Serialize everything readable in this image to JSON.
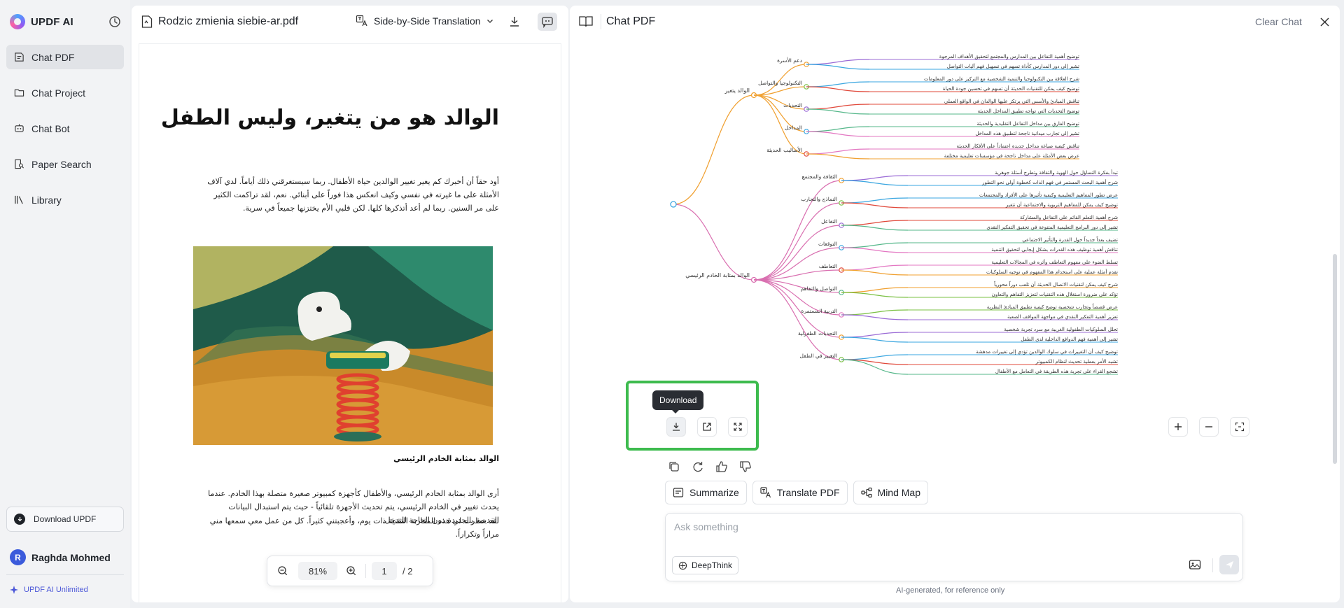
{
  "app": {
    "name": "UPDF AI"
  },
  "sidebar": {
    "items": [
      {
        "label": "Chat PDF",
        "icon": "chat-pdf-icon",
        "active": true
      },
      {
        "label": "Chat Project",
        "icon": "folder-icon"
      },
      {
        "label": "Chat Bot",
        "icon": "bot-icon"
      },
      {
        "label": "Paper Search",
        "icon": "search-doc-icon"
      },
      {
        "label": "Library",
        "icon": "library-icon"
      }
    ],
    "download_label": "Download UPDF",
    "user": {
      "initial": "R",
      "name": "Raghda Mohmed"
    },
    "plan_label": "UPDF AI Unlimited"
  },
  "pdf": {
    "file_name": "Rodzic zmienia siebie-ar.pdf",
    "translate_label": "Side-by-Side Translation",
    "title": "الوالد هو من يتغير، وليس الطفل",
    "para1": "أود حقاً أن أخبرك كم يغير تغيير الوالدين حياة الأطفال. ربما سيستغرقني ذلك أياماً. لدي آلاف الأمثلة على ما غيرته في نفسي وكيف انعكس هذا فوراً على أبنائي. نعم، لقد تراكمت الكثير على مر السنين. ربما لم أعد أتذكرها كلها. لكن قلبي الأم يختزنها جميعاً في سرية.",
    "caption": "الوالد بمثابة الخادم الرئيسي",
    "para2": "أرى الوالد بمثابة الخادم الرئيسي، والأطفال كأجهزة كمبيوتر صغيرة متصلة بهذا الخادم. عندما يحدث تغيير في الخادم الرئيسي، يتم تحديث الأجهزة تلقائياً - حيث يتم استبدال البيانات القديمة بالجديدة دون الحاجة للتدخل.",
    "para3": "لقد خطرت لي هذه المقارنة التقنية ذات يوم، وأعجبتني كثيراً. كل من عمل معي سمعها مني مراراً وتكراراً.",
    "zoom": "81%",
    "page_current": "1",
    "page_total": "/ 2"
  },
  "chat": {
    "title": "Chat PDF",
    "clear_label": "Clear Chat",
    "tooltip": "Download",
    "quick_actions": [
      "Summarize",
      "Translate PDF",
      "Mind Map"
    ],
    "ask_placeholder": "Ask something",
    "deepthink_label": "DeepThink",
    "footnote": "AI-generated, for reference only",
    "mindmap": {
      "branch_a": "الوالد يتغير",
      "branch_b": "الوالد بمثابة الخادم الرئيسي",
      "nodes_top": [
        "دعم الأسرة",
        "التكنولوجيا والتواصل",
        "التحديات",
        "المداخل",
        "الأساليب الحديثة"
      ],
      "nodes_bottom": [
        "الثقافة والمجتمع",
        "النماذج والتجارب",
        "التفاعل",
        "التوقعات",
        "التعاطف",
        "التواصل والتفاهم",
        "التربية المستمرة",
        "التحديات الطفولية",
        "التغيير في الطفل"
      ],
      "leaves_top": [
        "توضيح أهمية التفاعل بين المدارس والمجتمع لتحقيق الأهداف المرجوة",
        "تشير إلى دور المدارس كأداة تسهم في تسهيل فهم آليات التواصل",
        "شرح العلاقة بين التكنولوجيا والتنمية الشخصية مع التركيز على دور المعلومات",
        "توضيح كيف يمكن للتقنيات الحديثة أن تسهم في تحسين جودة الحياة",
        "تناقش المبادئ والأسس التي يرتكز عليها الوالدان في الواقع العملي",
        "توضيح التحديات التي تواجه تطبيق المداخل الحديثة",
        "توضيح الفارق بين مداخل التفاعل التقليدية والحديثة",
        "تشير إلى تجارب ميدانية ناجحة لتطبيق هذه المداخل",
        "تناقش كيفية صياغة مداخل جديدة اعتماداً على الأفكار الحديثة",
        "عرض بعض الأمثلة على مداخل ناجحة في مؤسسات تعليمية مختلفة"
      ],
      "leaves_bottom": [
        "تبدأ بفكرة التساؤل حول الهوية والثقافة وتطرح أسئلة جوهرية",
        "شرح أهمية البحث المستمر في فهم الذات كخطوة أولى نحو التطور",
        "عرض تطور المفاهيم التعليمية وكيفية تأثيرها على الأفراد والمجتمعات",
        "توضيح كيف يمكن للمفاهيم التربوية والاجتماعية أن تتغير",
        "شرح أهمية التعلم القائم على التفاعل والمشاركة",
        "تشير إلى دور البرامج التعليمية المتنوعة في تحقيق التفكير النقدي",
        "تضيف بعداً جديداً حول القدرة والتأثير الاجتماعي",
        "تناقش أهمية توظيف هذه القدرات بشكل إيجابي لتحقيق التنمية",
        "تسلط الضوء على مفهوم التعاطف وأثره في المجالات التعليمية",
        "تقدم أمثلة عملية على استخدام هذا المفهوم في توجيه السلوكيات",
        "شرح كيف يمكن لتقنيات الاتصال الحديثة أن تلعب دوراً محورياً",
        "تؤكد على ضرورة استغلال هذه التقنيات لتعزيز التفاهم والتعاون",
        "عرض قصصاً وتجارب شخصية توضح كيفية تطبيق المبادئ النظرية",
        "تعزيز أهمية التفكير النقدي في مواجهة المواقف الصعبة",
        "تحلل السلوكيات الطفولية الغريبة مع سرد تجربة شخصية",
        "تشير إلى أهمية فهم الدوافع الداخلية لدى الطفل",
        "توضيح كيف أن التغييرات في سلوك الوالدين تؤدي إلى تغييرات مدهشة",
        "تشبه الأمر بعملية تحديث لنظام الكمبيوتر",
        "تشجع القراء على تجربة هذه الطريقة في التعامل مع الأطفال"
      ]
    }
  },
  "colors": {
    "accent": "#4b57d8",
    "highlight": "#3dbb4e",
    "branch_a": "#f0a030",
    "branch_b": "#d96fb0",
    "lines": [
      "#f0a030",
      "#7bc043",
      "#9b6bd6",
      "#3aa6e0",
      "#e0483a",
      "#55b78a",
      "#e377c2"
    ]
  }
}
